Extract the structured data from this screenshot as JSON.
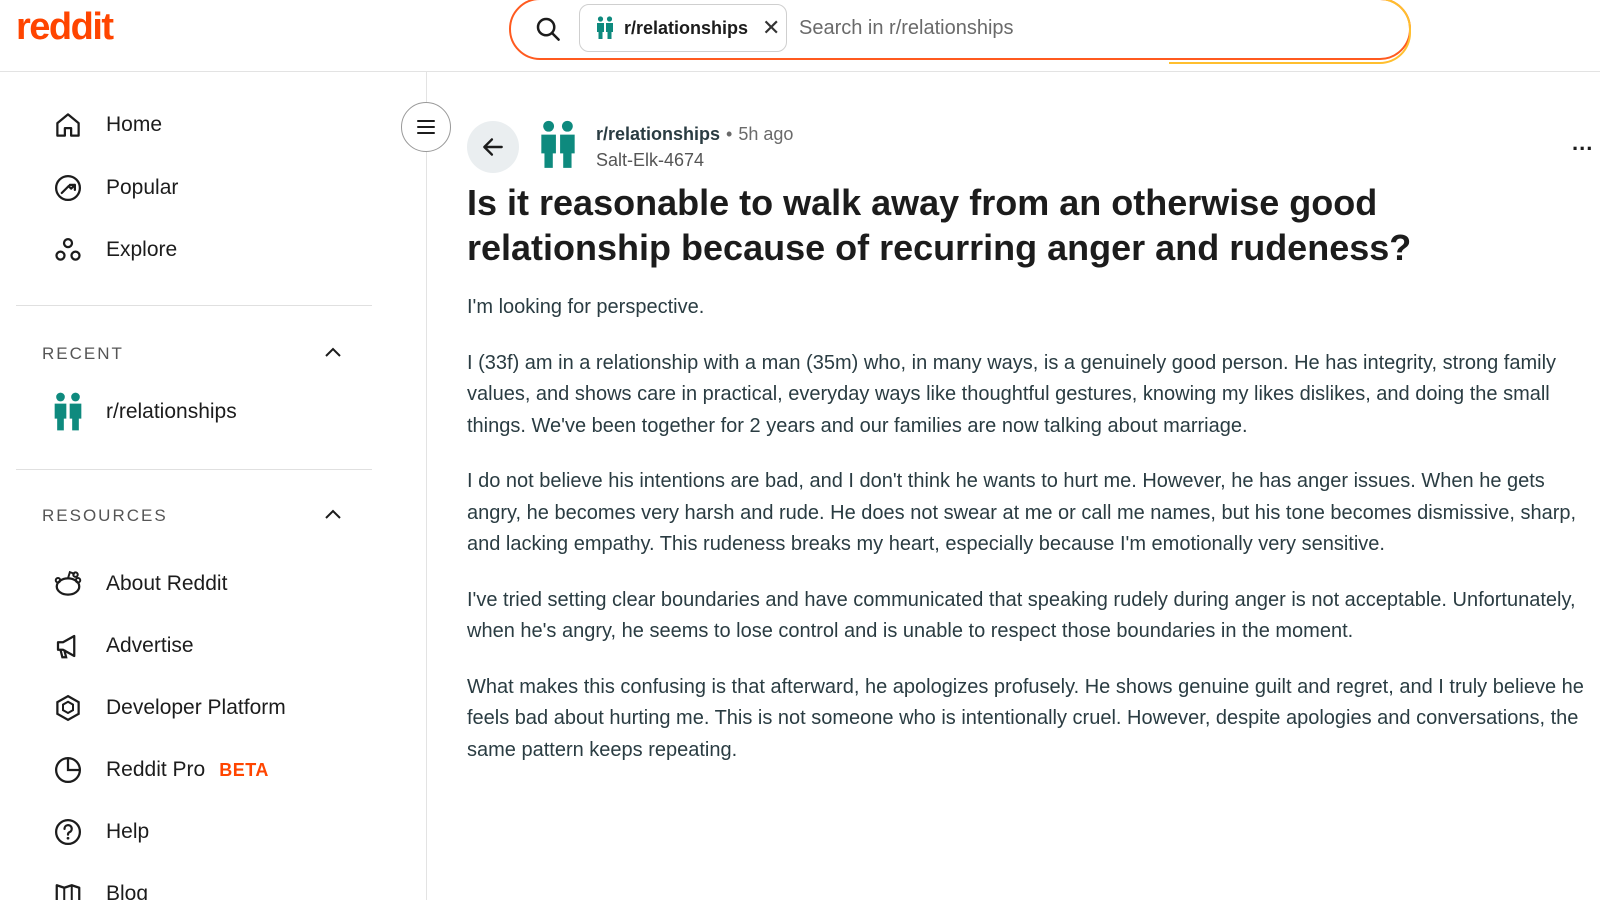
{
  "header": {
    "logo": "reddit",
    "search_chip": "r/relationships",
    "search_placeholder": "Search in r/relationships"
  },
  "sidebar": {
    "nav": [
      {
        "label": "Home",
        "icon": "home-icon"
      },
      {
        "label": "Popular",
        "icon": "popular-icon"
      },
      {
        "label": "Explore",
        "icon": "explore-icon"
      }
    ],
    "recent_title": "RECENT",
    "recent_items": [
      {
        "label": "r/relationships",
        "icon": "relationships-icon"
      }
    ],
    "resources_title": "RESOURCES",
    "resources": [
      {
        "label": "About Reddit",
        "icon": "reddit-alien-icon"
      },
      {
        "label": "Advertise",
        "icon": "megaphone-icon"
      },
      {
        "label": "Developer Platform",
        "icon": "developer-icon"
      },
      {
        "label": "Reddit Pro",
        "icon": "pro-icon",
        "badge": "BETA"
      },
      {
        "label": "Help",
        "icon": "help-icon"
      },
      {
        "label": "Blog",
        "icon": "blog-icon"
      }
    ]
  },
  "post": {
    "subreddit": "r/relationships",
    "separator": "•",
    "time": "5h ago",
    "author": "Salt-Elk-4674",
    "more": "...",
    "title": "Is it reasonable to walk away from an otherwise good relationship because of recurring anger and rudeness?",
    "paragraphs": [
      "I'm looking for perspective.",
      "I (33f) am in a relationship with a man (35m) who, in many ways, is a genuinely good person. He has integrity, strong family values, and shows care in practical, everyday ways like thoughtful gestures, knowing my likes dislikes, and doing the small things. We've been together for 2 years and our families are now talking about marriage.",
      "I do not believe his intentions are bad, and I don't think he wants to hurt me. However, he has anger issues. When he gets angry, he becomes very harsh and rude. He does not swear at me or call me names, but his tone becomes dismissive, sharp, and lacking empathy. This rudeness breaks my heart, especially because I'm emotionally very sensitive.",
      "I've tried setting clear boundaries and have communicated that speaking rudely during anger is not acceptable. Unfortunately, when he's angry, he seems to lose control and is unable to respect those boundaries in the moment.",
      "What makes this confusing is that afterward, he apologizes profusely. He shows genuine guilt and regret, and I truly believe he feels bad about hurting me. This is not someone who is intentionally cruel. However, despite apologies and conversations, the same pattern keeps repeating."
    ]
  },
  "colors": {
    "brand": "#ff4500",
    "subreddit_icon": "#0e8a7e"
  }
}
